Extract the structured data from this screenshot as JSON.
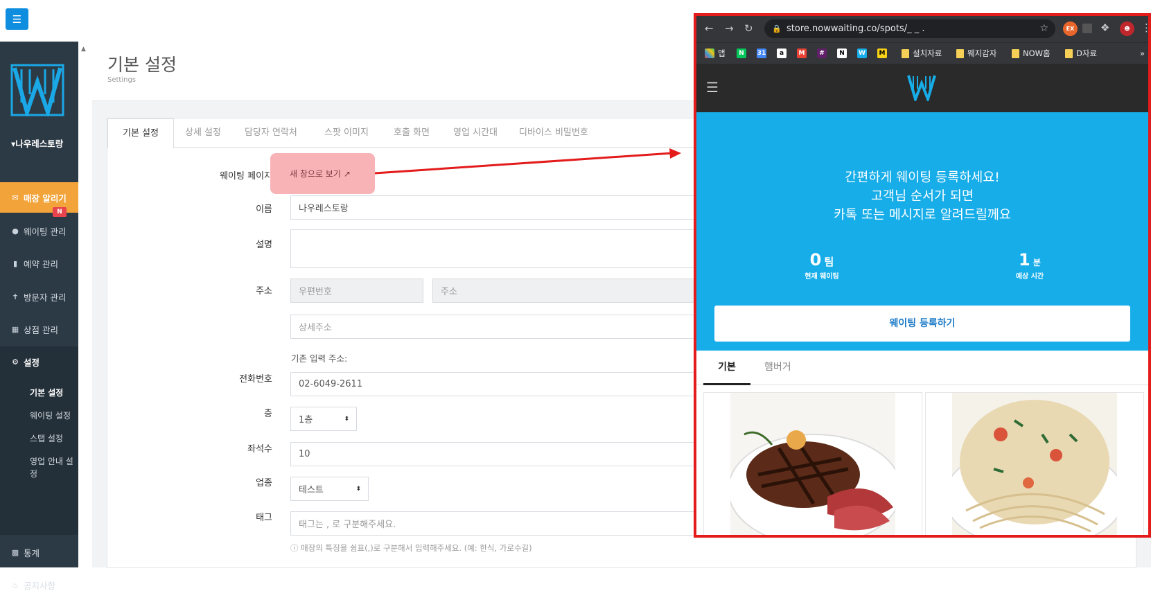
{
  "sidebar": {
    "store_name": "나우레스토랑",
    "items": [
      {
        "label": "매장 알리기",
        "icon": "megaphone-icon",
        "badge": "N"
      },
      {
        "label": "웨이팅 관리",
        "icon": "users-icon"
      },
      {
        "label": "예약 관리",
        "icon": "bookmark-icon"
      },
      {
        "label": "방문자 관리",
        "icon": "person-icon"
      },
      {
        "label": "상점 관리",
        "icon": "building-icon"
      },
      {
        "label": "설정",
        "icon": "gear-icon"
      },
      {
        "label": "통계",
        "icon": "bar-chart-icon"
      },
      {
        "label": "공지사항",
        "icon": "bell-icon"
      }
    ],
    "sub_items": [
      "기본 설정",
      "웨이팅 설정",
      "스탭 설정",
      "영업 안내 설정"
    ]
  },
  "page": {
    "title": "기본 설정",
    "subtitle": "Settings"
  },
  "tabs": [
    "기본 설정",
    "상세 설정",
    "담당자 연락처",
    "스팟 이미지",
    "호출 화면",
    "영업 시간대",
    "디바이스 비밀번호"
  ],
  "form": {
    "waiting_page_label": "웨이팅 페이지",
    "new_window_label": "새 창으로 보기",
    "name_label": "이름",
    "name_value": "나우레스토랑",
    "desc_label": "설명",
    "address_label": "주소",
    "zipcode_placeholder": "우편번호",
    "address_placeholder": "주소",
    "detail_address_placeholder": "상세주소",
    "existing_address": "기존 입력 주소:",
    "phone_label": "전화번호",
    "phone_value": "02-6049-2611",
    "floor_label": "층",
    "floor_value": "1층",
    "seats_label": "좌석수",
    "seats_value": "10",
    "category_label": "업종",
    "category_value": "테스트",
    "tag_label": "태그",
    "tag_placeholder": "태그는 , 로 구분해주세요.",
    "tag_help": "매장의 특징을 쉼표(,)로 구분해서 입력해주세요. (예: 한식, 가로수길)"
  },
  "browser": {
    "url": "store.nowwaiting.co/spots/_ _ .",
    "bookmarks": [
      "앱",
      "설치자료",
      "웨지감자",
      "NOW홈",
      "D자료"
    ],
    "site": {
      "hero_lines": [
        "간편하게 웨이팅 등록하세요!",
        "고객님 순서가 되면",
        "카톡 또는 메시지로 알려드릴께요"
      ],
      "waiting_count": "0",
      "waiting_unit": "팀",
      "waiting_label": "현재 웨이팅",
      "expected_time": "1",
      "expected_unit": "분",
      "expected_label": "예상 시간",
      "register_label": "웨이팅 등록하기",
      "tabs": [
        "기본",
        "햄버거"
      ]
    }
  },
  "colors": {
    "sidebar_bg": "#2c3a46",
    "active_menu": "#f2a33a",
    "hero_blue": "#17ade9",
    "highlight_red": "#e31b1b",
    "button_pink": "#f8b3b7"
  }
}
